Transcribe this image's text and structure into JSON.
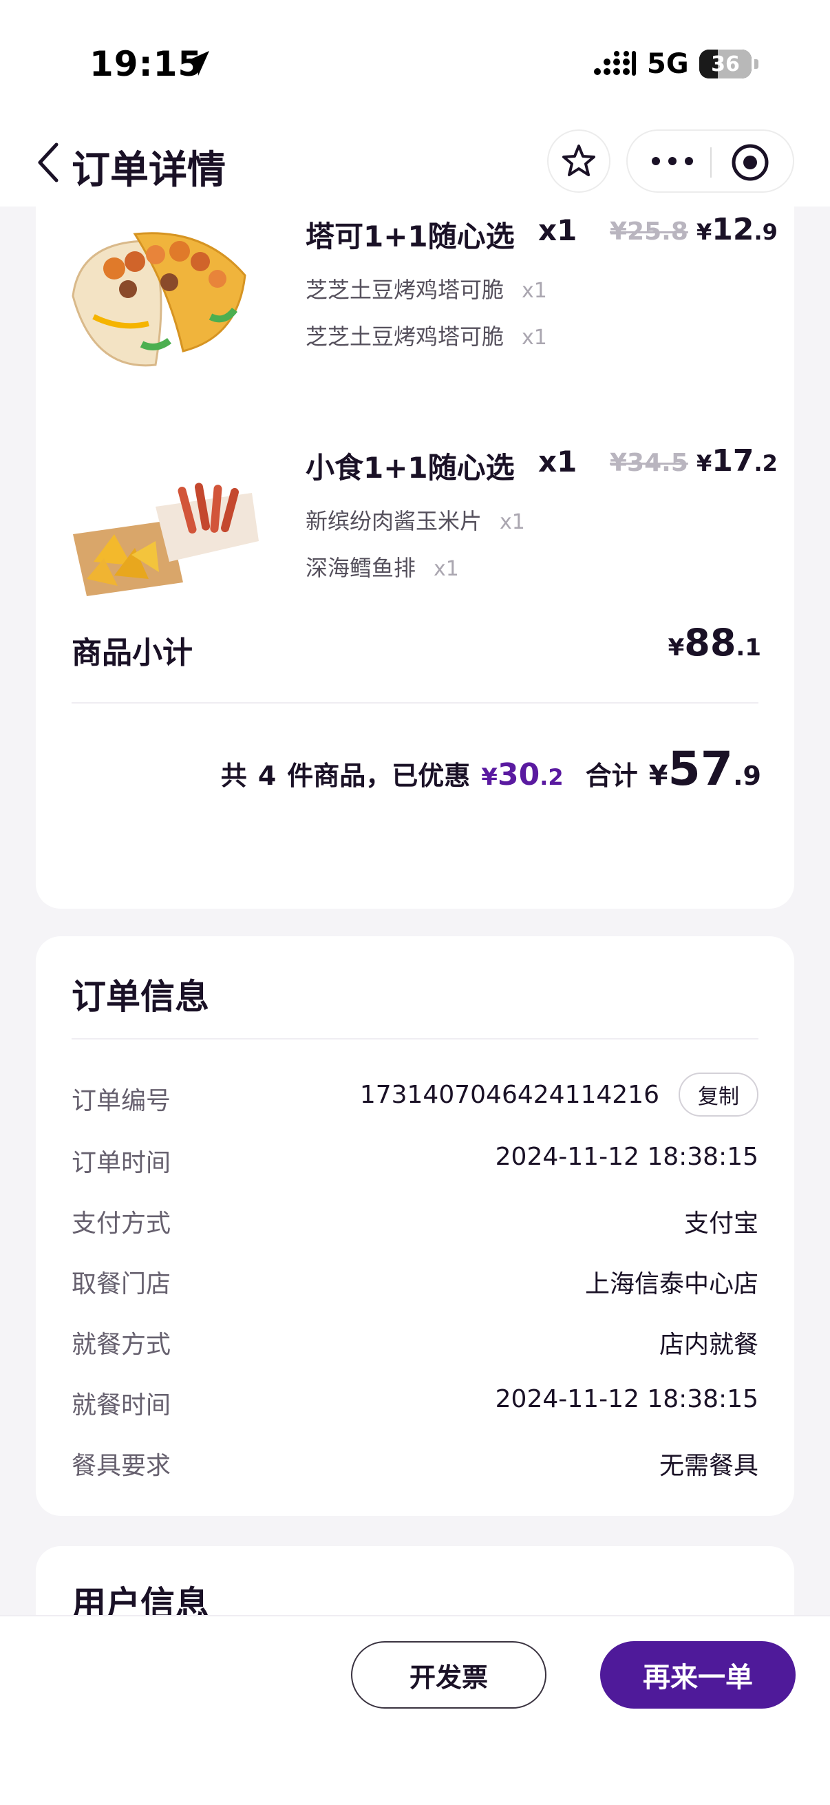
{
  "status_bar": {
    "time": "19:15",
    "network": "5G",
    "battery_level": "36",
    "battery_fraction": 0.36
  },
  "nav": {
    "title": "订单详情",
    "back_icon": "chevron-left-icon",
    "star_icon": "star-icon",
    "more_icon": "more-dots-icon",
    "close_icon": "target-icon"
  },
  "products": [
    {
      "name": "塔可1+1随心选",
      "qty": "x1",
      "original_price": "¥25.8",
      "price_yen": "¥",
      "price_int": "12",
      "price_dec": ".9",
      "options": [
        {
          "name": "芝芝土豆烤鸡塔可脆",
          "qty": "x1"
        },
        {
          "name": "芝芝土豆烤鸡塔可脆",
          "qty": "x1"
        }
      ]
    },
    {
      "name": "小食1+1随心选",
      "qty": "x1",
      "original_price": "¥34.5",
      "price_yen": "¥",
      "price_int": "17",
      "price_dec": ".2",
      "options": [
        {
          "name": "新缤纷肉酱玉米片",
          "qty": "x1"
        },
        {
          "name": "深海鳕鱼排",
          "qty": "x1"
        }
      ]
    }
  ],
  "subtotal": {
    "label": "商品小计",
    "yen": "¥",
    "int": "88",
    "dec": ".1"
  },
  "summary": {
    "prefix": "共",
    "count": "4",
    "middle": "件商品，已优惠",
    "discount_yen": "¥",
    "discount_int": "30",
    "discount_dec": ".2",
    "total_label": "合计",
    "total_yen": "¥",
    "total_int": "57",
    "total_dec": ".9"
  },
  "order_info": {
    "title": "订单信息",
    "copy_label": "复制",
    "rows": [
      {
        "label": "订单编号",
        "value": "1731407046424114216"
      },
      {
        "label": "订单时间",
        "value": "2024-11-12 18:38:15"
      },
      {
        "label": "支付方式",
        "value": "支付宝"
      },
      {
        "label": "取餐门店",
        "value": "上海信泰中心店"
      },
      {
        "label": "就餐方式",
        "value": "店内就餐"
      },
      {
        "label": "就餐时间",
        "value": "2024-11-12 18:38:15"
      },
      {
        "label": "餐具要求",
        "value": "无需餐具"
      }
    ]
  },
  "user_info": {
    "title": "用户信息"
  },
  "bottom_bar": {
    "invoice_label": "开发票",
    "reorder_label": "再来一单"
  },
  "colors": {
    "accent": "#4f1a9a",
    "discount": "#5a1aa0",
    "background": "#f5f4f7"
  }
}
